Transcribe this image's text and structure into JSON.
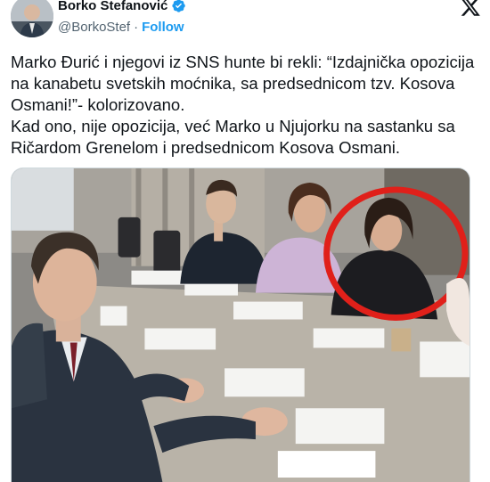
{
  "author": {
    "display_name": "Borko Stefanović",
    "handle": "@BorkoStef",
    "separator": "·",
    "follow_label": "Follow"
  },
  "tweet": {
    "text": "Marko Đurić i njegovi iz SNS hunte bi rekli: “Izdajnička opozicija na kanabetu svetskih moćnika, sa predsednicom tzv. Kosova Osmani!”- kolorizovano.\nKad ono, nije opozicija, već Marko u Njujorku na sastanku sa Ričardom Grenelom i predsednicom Kosova Osmani."
  },
  "icons": [
    "verified-badge-icon",
    "x-logo-icon"
  ],
  "colors": {
    "accent": "#1d9bf0",
    "text": "#0f1419",
    "secondary": "#536471",
    "highlight_circle": "#e0201a"
  }
}
